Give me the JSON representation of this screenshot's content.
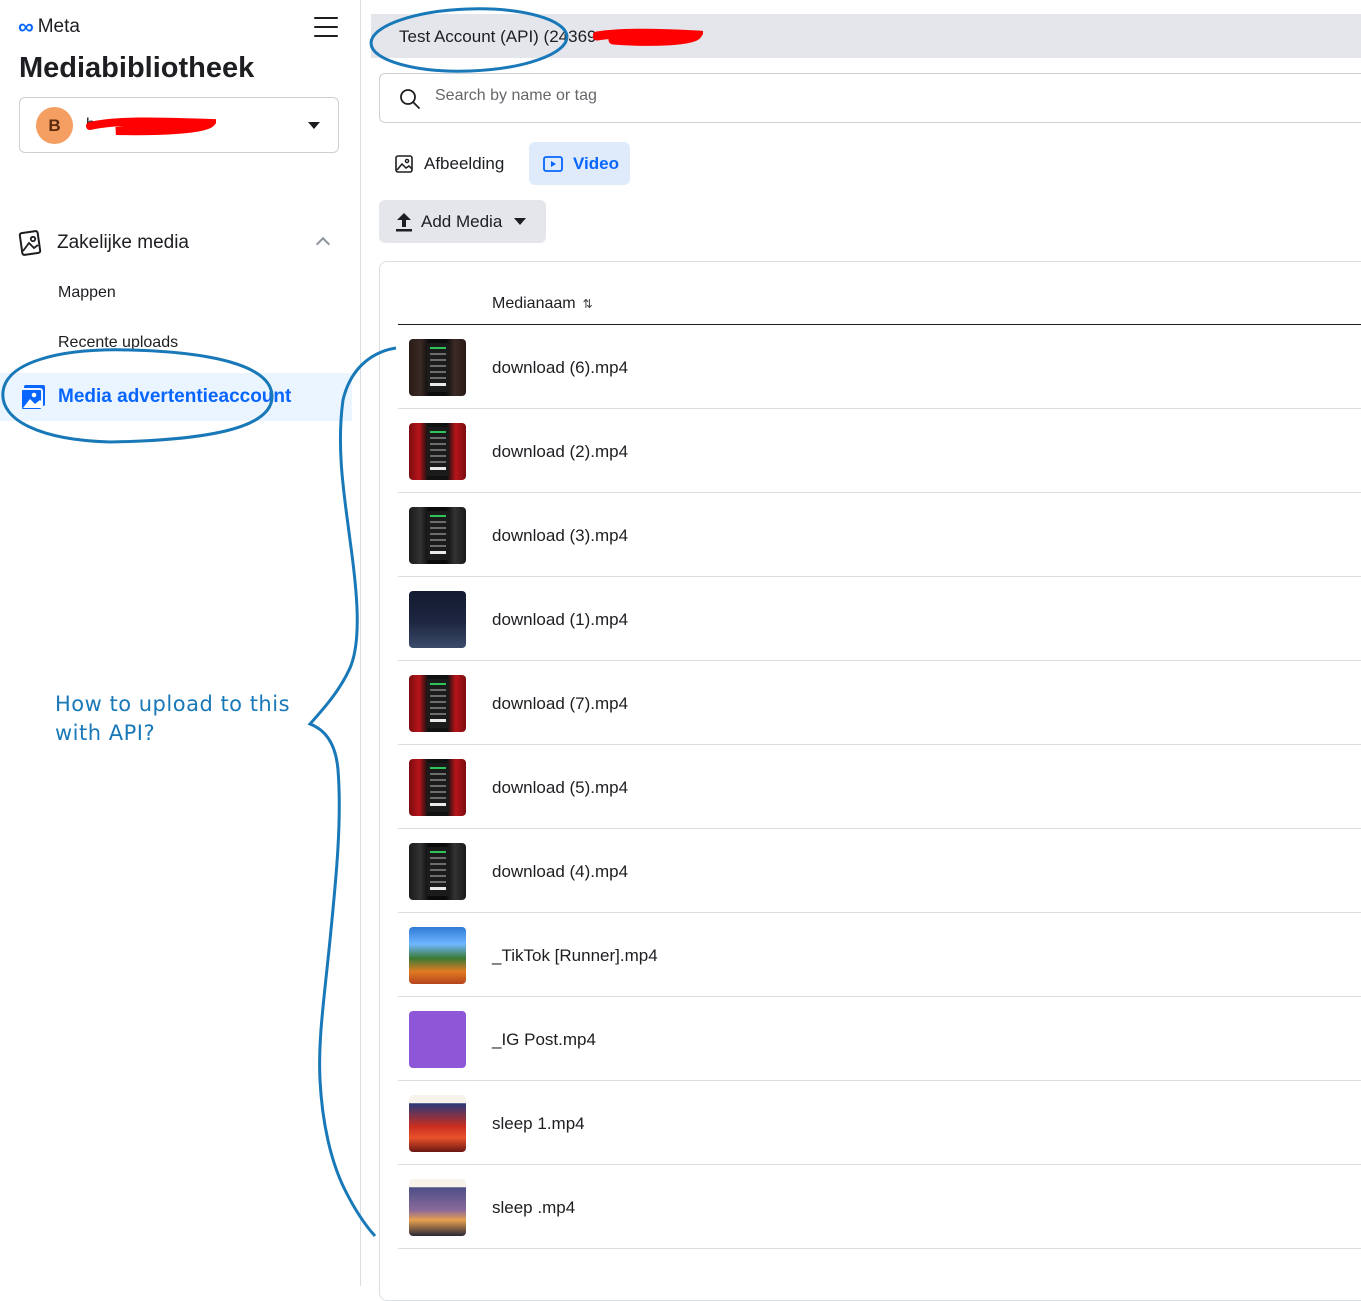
{
  "app": {
    "brand": "Meta",
    "title": "Mediabibliotheek"
  },
  "account_select": {
    "avatar_letter": "B",
    "name_visible": "b"
  },
  "nav": {
    "group_label": "Zakelijke media",
    "sub_items": [
      "Mappen",
      "Recente uploads"
    ],
    "active_label": "Media advertentieaccount"
  },
  "topbar": {
    "account_label": "Test Account (API) (24369"
  },
  "search": {
    "placeholder": "Search by name or tag"
  },
  "tabs": [
    {
      "label": "Afbeelding",
      "active": false,
      "icon": "image-icon"
    },
    {
      "label": "Video",
      "active": true,
      "icon": "video-icon"
    }
  ],
  "add_media": {
    "label": "Add Media"
  },
  "table": {
    "column_header": "Medianaam",
    "rows": [
      {
        "name": "download (6).mp4",
        "thumb": "phone"
      },
      {
        "name": "download (2).mp4",
        "thumb": "red"
      },
      {
        "name": "download (3).mp4",
        "thumb": "dark"
      },
      {
        "name": "download (1).mp4",
        "thumb": "night"
      },
      {
        "name": "download (7).mp4",
        "thumb": "red"
      },
      {
        "name": "download (5).mp4",
        "thumb": "red"
      },
      {
        "name": "download (4).mp4",
        "thumb": "dark"
      },
      {
        "name": "_TikTok [Runner].mp4",
        "thumb": "game"
      },
      {
        "name": "_IG Post.mp4",
        "thumb": "purple"
      },
      {
        "name": "sleep 1.mp4",
        "thumb": "sunset"
      },
      {
        "name": "sleep .mp4",
        "thumb": "road"
      }
    ]
  },
  "annotation": {
    "line1": "How to upload to this",
    "line2": "with API?",
    "color": "#1878b8"
  },
  "colors": {
    "accent": "#0866ff",
    "redaction": "#ff0000"
  }
}
